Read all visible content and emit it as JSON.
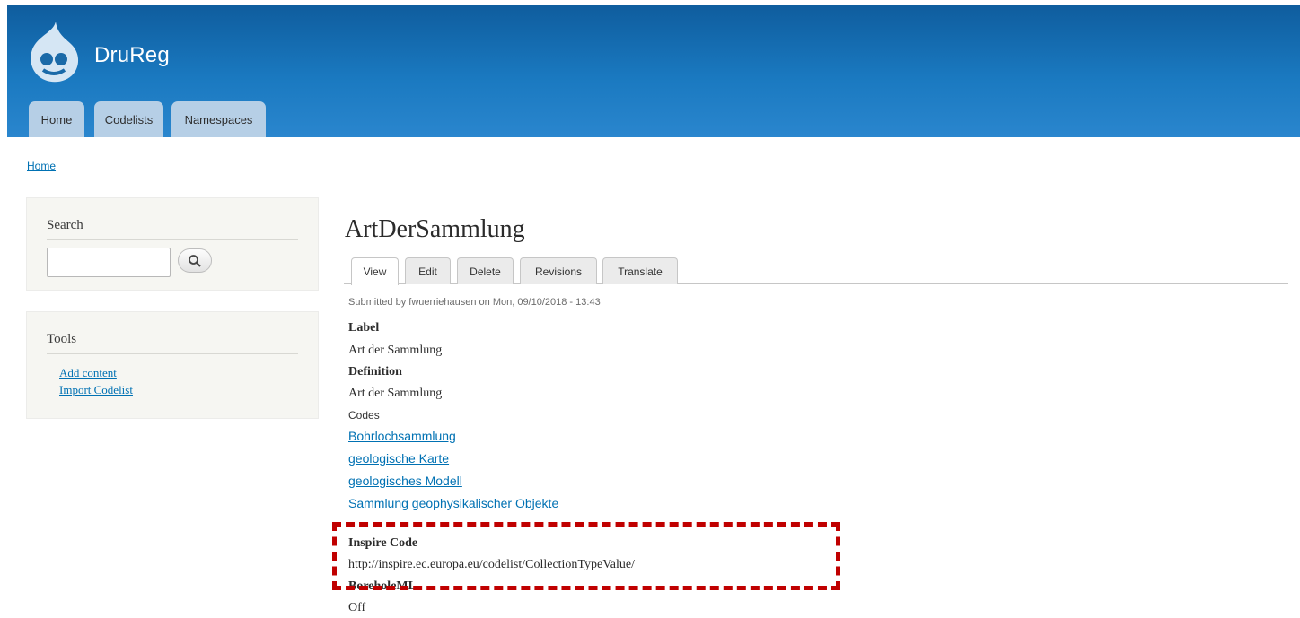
{
  "header": {
    "site_name": "DruReg",
    "menu": [
      {
        "label": "Home"
      },
      {
        "label": "Codelists"
      },
      {
        "label": "Namespaces"
      }
    ],
    "colors": {
      "header": "#1a79c0",
      "menu_tab": "#b6cfe6"
    }
  },
  "breadcrumb": {
    "home": "Home"
  },
  "sidebar": {
    "search": {
      "title": "Search",
      "placeholder": "",
      "button_icon": "magnifier-icon"
    },
    "tools": {
      "title": "Tools",
      "links": [
        {
          "label": "Add content"
        },
        {
          "label": "Import Codelist"
        }
      ]
    }
  },
  "main": {
    "title": "ArtDerSammlung",
    "tabs": [
      {
        "label": "View",
        "active": true
      },
      {
        "label": "Edit"
      },
      {
        "label": "Delete"
      },
      {
        "label": "Revisions"
      },
      {
        "label": "Translate"
      }
    ],
    "submitted": "Submitted by fwuerriehausen on Mon, 09/10/2018 - 13:43",
    "fields": {
      "label_title": "Label",
      "label_value": "Art der Sammlung",
      "definition_title": "Definition",
      "definition_value": "Art der Sammlung",
      "codes_title": "Codes",
      "codes": [
        "Bohrlochsammlung",
        "geologische Karte",
        "geologisches Modell",
        "Sammlung geophysikalischer Objekte"
      ],
      "inspire_title": "Inspire Code",
      "inspire_value": "http://inspire.ec.europa.eu/codelist/CollectionTypeValue/",
      "boreholeml_title": "BoreholeML",
      "boreholeml_value": "Off"
    },
    "link_color": "#0071b3",
    "highlight_color": "#c00000"
  }
}
